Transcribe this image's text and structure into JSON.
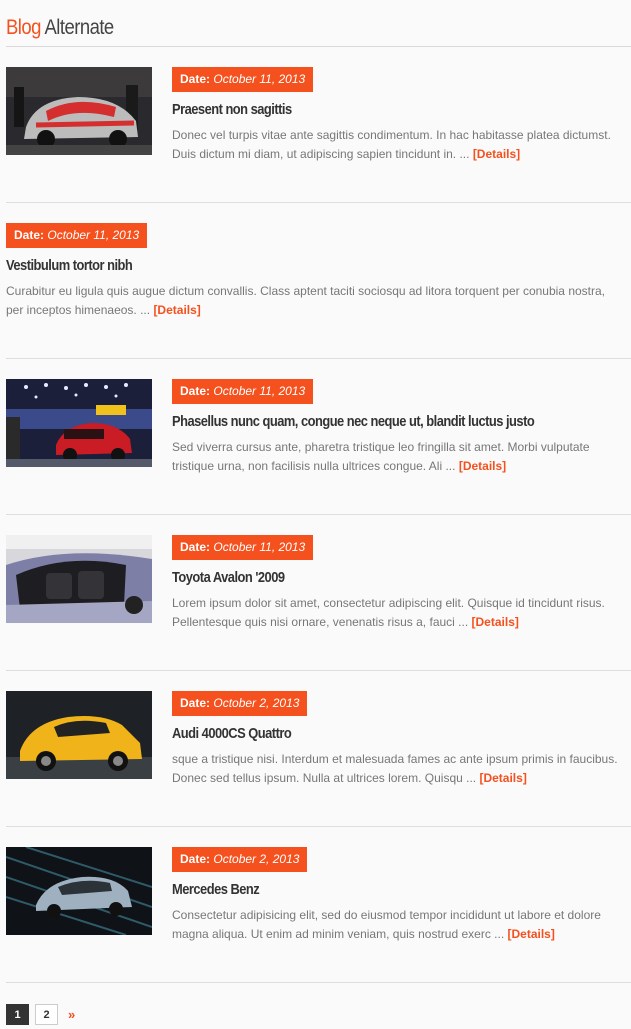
{
  "page": {
    "title_accent": "Blog",
    "title_rest": "Alternate"
  },
  "posts": [
    {
      "date_label": "Date:",
      "date": "October 11, 2013",
      "title": "Praesent non sagittis",
      "excerpt": "Donec vel turpis vitae ante sagittis condimentum. In hac habitasse platea dictumst. Duis dictum mi diam, ut adipiscing sapien tincidunt in. ...",
      "details": "[Details]"
    },
    {
      "date_label": "Date:",
      "date": "October 11, 2013",
      "title": "Vestibulum tortor nibh",
      "excerpt": "Curabitur eu ligula quis augue dictum convallis. Class aptent taciti sociosqu ad litora torquent per conubia nostra, per inceptos himenaeos. ...",
      "details": "[Details]"
    },
    {
      "date_label": "Date:",
      "date": "October 11, 2013",
      "title": "Phasellus nunc quam, congue nec neque ut, blandit luctus justo",
      "excerpt": "Sed viverra cursus ante, pharetra tristique leo fringilla sit amet. Morbi vulputate tristique urna, non facilisis nulla ultrices congue. Ali ...",
      "details": "[Details]"
    },
    {
      "date_label": "Date:",
      "date": "October 11, 2013",
      "title": "Toyota Avalon '2009",
      "excerpt": "Lorem ipsum dolor sit amet, consectetur adipiscing elit. Quisque id tincidunt risus. Pellentesque quis nisi ornare, venenatis risus a, fauci ...",
      "details": "[Details]"
    },
    {
      "date_label": "Date:",
      "date": "October 2, 2013",
      "title": "Audi 4000CS Quattro",
      "excerpt": "sque a tristique nisi. Interdum et malesuada fames ac ante ipsum primis in faucibus. Donec sed tellus ipsum. Nulla at ultrices lorem. Quisqu ...",
      "details": "[Details]"
    },
    {
      "date_label": "Date:",
      "date": "October 2, 2013",
      "title": "Mercedes Benz",
      "excerpt": "Consectetur adipisicing elit, sed do eiusmod tempor incididunt ut labore et dolore magna aliqua. Ut enim ad minim veniam, quis nostrud exerc ...",
      "details": "[Details]"
    }
  ],
  "pagination": {
    "pages": [
      "1",
      "2"
    ],
    "next": "»"
  },
  "colors": {
    "accent": "#f4511e",
    "title_text": "#444444",
    "body_text": "#777777"
  }
}
